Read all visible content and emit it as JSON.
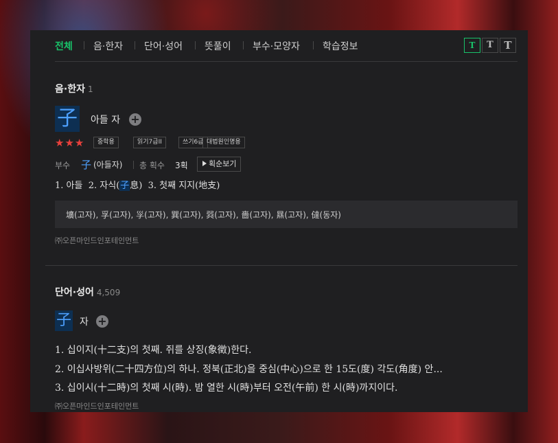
{
  "tabs": {
    "items": [
      "전체",
      "음·한자",
      "단어·성어",
      "뜻풀이",
      "부수·모양자",
      "학습정보"
    ],
    "font_size_buttons": [
      "T",
      "T",
      "T"
    ]
  },
  "hanja_section": {
    "title": "음·한자",
    "count": "1",
    "character": "子",
    "reading": "아들 자",
    "plus_icon": "+",
    "stars": "★★★",
    "badges": [
      "중학용",
      "읽기7급II",
      "쓰기6급",
      "대법원인명용"
    ],
    "radical_label": "부수",
    "radical_char": "子",
    "radical_name": "(아들자)",
    "strokes_label": "총 획수",
    "strokes_value": "3획",
    "stroke_order_button": "획순보기",
    "meanings": {
      "m1": "1. 아들",
      "m2_prefix": "2. 자식(",
      "m2_hl": "子",
      "m2_suffix": "息)",
      "m3": "3. 첫째 지지(地支)"
    },
    "related": "壙(고자), 孚(고자), 㜽(고자), 巽(고자), 㢲(고자), 嗇(고자), 㬎(고자), 㒓(동자)",
    "copyright": "㈜오픈마인드인포테인먼트"
  },
  "word_section": {
    "title": "단어·성어",
    "count": "4,509",
    "character": "子",
    "reading": "자",
    "plus_icon": "+",
    "definitions": [
      "1. 십이지(十二支)의 첫째. 쥐를 상징(象徵)한다.",
      "2. 이십사방위(二十四方位)의 하나. 정북(正北)을 중심(中心)으로 한 15도(度) 각도(角度) 안...",
      "3. 십이시(十二時)의 첫째 시(時). 밤 열한 시(時)부터 오전(午前) 한 시(時)까지이다."
    ],
    "copyright": "㈜오픈마인드인포테인먼트"
  },
  "colors": {
    "accent": "#19c36a",
    "hanja_blue": "#4da0ff",
    "hanja_bg": "#0d2f52",
    "star": "#e8403c",
    "panel_bg": "#1f1f21"
  }
}
